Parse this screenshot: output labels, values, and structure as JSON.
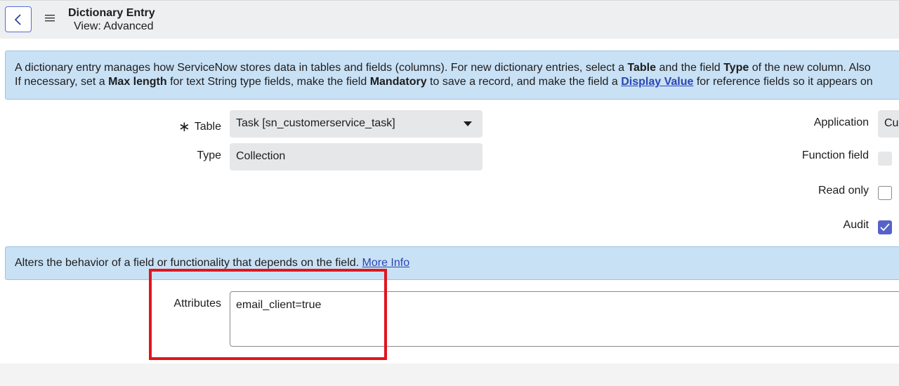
{
  "header": {
    "title": "Dictionary Entry",
    "subtitle": "View: Advanced",
    "back_icon": "chevron-left-icon",
    "menu_icon": "hamburger-menu-icon"
  },
  "info_banner": {
    "line1_parts": [
      "A dictionary entry manages how ServiceNow stores data in tables and fields (columns). For new dictionary entries, select a ",
      "Table",
      " and the field ",
      "Type",
      " of the new column. Also"
    ],
    "line2_parts": [
      "If necessary, set a ",
      "Max length",
      " for text String type fields, make the field ",
      "Mandatory",
      " to save a record, and make the field a ",
      "Display Value",
      " for reference fields so it appears on"
    ]
  },
  "form": {
    "table": {
      "label": "Table",
      "value": "Task [sn_customerservice_task]",
      "required_mark": "∗"
    },
    "type": {
      "label": "Type",
      "value": "Collection"
    },
    "application": {
      "label": "Application",
      "value": "Cu"
    },
    "function_field": {
      "label": "Function field",
      "checked": false,
      "disabled": true
    },
    "read_only": {
      "label": "Read only",
      "checked": false
    },
    "audit": {
      "label": "Audit",
      "checked": true
    }
  },
  "attributes_banner": {
    "text": "Alters the behavior of a field or functionality that depends on the field. ",
    "link": "More Info"
  },
  "attributes": {
    "label": "Attributes",
    "value": "email_client=true"
  },
  "colors": {
    "banner_bg": "#c9e1f5",
    "link": "#2a46b4",
    "checkbox_checked": "#5662c8",
    "highlight": "#e0161d"
  }
}
